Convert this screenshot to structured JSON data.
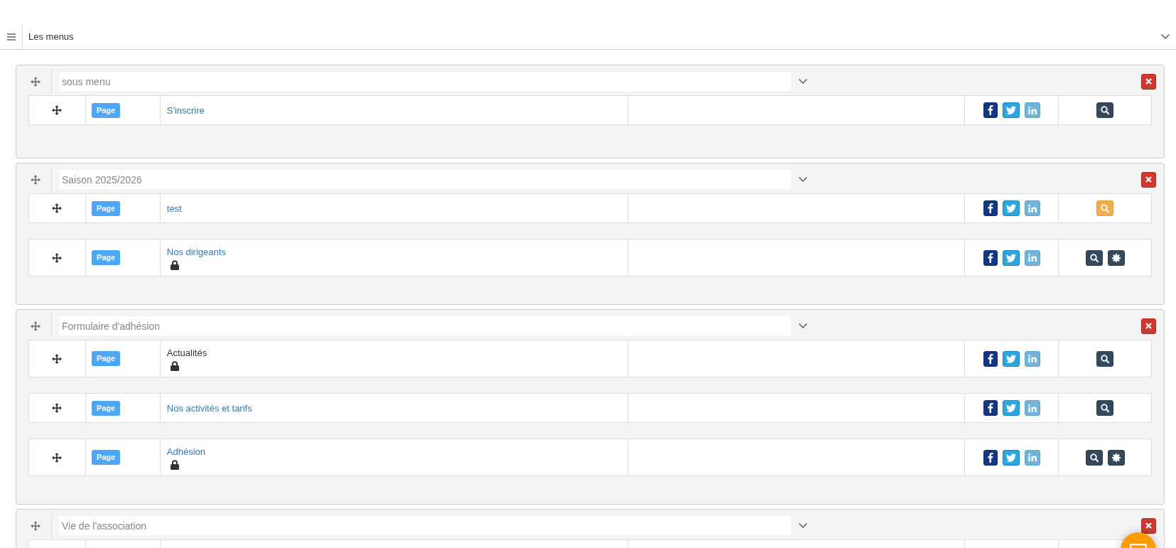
{
  "topbar": {
    "title": "Les menus"
  },
  "groups": [
    {
      "value": "sous menu",
      "items": [
        {
          "kind": "entry",
          "type": "Page",
          "title": "S'inscrire",
          "linked": true,
          "locked": false,
          "search_highlighted": false,
          "settings": false
        }
      ]
    },
    {
      "value": "Saison 2025/2026",
      "items": [
        {
          "kind": "entry",
          "type": "Page",
          "title": "test",
          "linked": true,
          "locked": false,
          "search_highlighted": true,
          "settings": false
        },
        {
          "kind": "entry",
          "type": "Page",
          "title": "Nos dirigeants",
          "linked": true,
          "locked": true,
          "search_highlighted": false,
          "settings": true
        }
      ]
    },
    {
      "value": "Formulaire d'adhésion",
      "items": [
        {
          "kind": "entry",
          "type": "Page",
          "title": "Actualités",
          "linked": false,
          "locked": true,
          "search_highlighted": false,
          "settings": false
        },
        {
          "kind": "entry",
          "type": "Page",
          "title": "Nos activités et tarifs",
          "linked": true,
          "locked": false,
          "search_highlighted": false,
          "settings": false
        },
        {
          "kind": "entry",
          "type": "Page",
          "title": "Adhésion",
          "linked": true,
          "locked": true,
          "search_highlighted": false,
          "settings": true
        }
      ]
    },
    {
      "value": "Vie de l'association",
      "items": [
        {
          "kind": "clipped"
        }
      ]
    }
  ]
}
